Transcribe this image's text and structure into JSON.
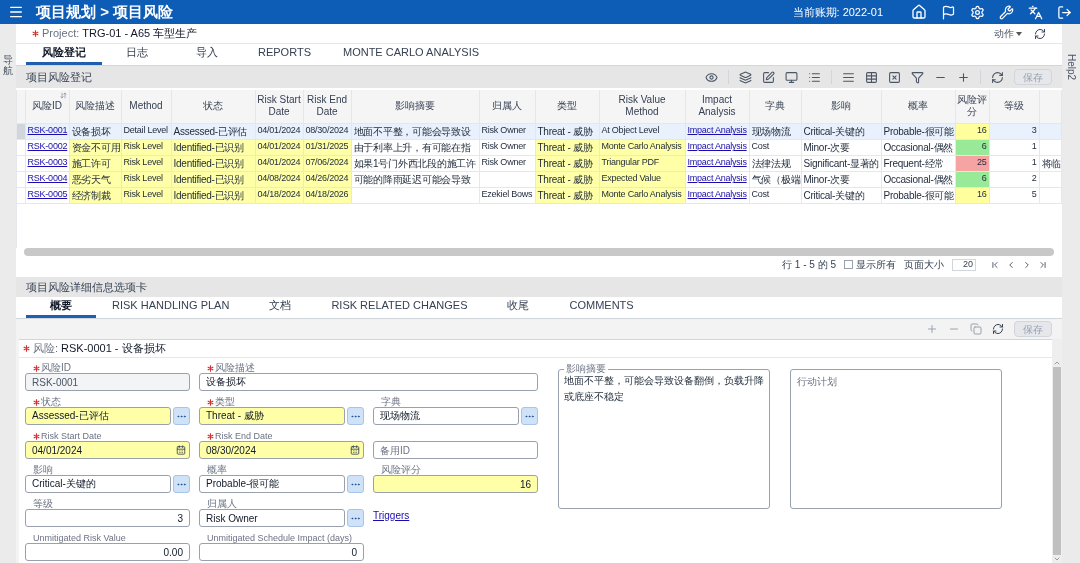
{
  "app_bar": {
    "title": "项目规划 > 项目风险",
    "period": "当前账期: 2022-01"
  },
  "side_panels": {
    "left": "导航",
    "right": "Help2"
  },
  "project": {
    "label": "Project:",
    "value": "TRG-01 - A65 车型生产",
    "required": true,
    "actions": "动作"
  },
  "tabs": [
    {
      "label": "风险登记",
      "selected": true
    },
    {
      "label": "日志",
      "selected": false
    },
    {
      "label": "导入",
      "selected": false
    },
    {
      "label": "REPORTS",
      "selected": false
    },
    {
      "label": "MONTE CARLO ANALYSIS",
      "selected": false
    }
  ],
  "register": {
    "title": "项目风险登记",
    "save": {
      "label": "保存",
      "disabled": true
    },
    "columns": [
      {
        "label": "风险ID",
        "kind": "link",
        "sorted": true
      },
      {
        "label": "风险描述",
        "kind": "required",
        "sorted": false
      },
      {
        "label": "Method",
        "kind": "required",
        "sorted": false
      },
      {
        "label": "状态",
        "kind": "required",
        "sorted": false
      },
      {
        "label": "Risk Start Date",
        "kind": "required",
        "sorted": false
      },
      {
        "label": "Risk End Date",
        "kind": "required",
        "sorted": false
      },
      {
        "label": "影响摘要",
        "kind": "text",
        "sorted": false
      },
      {
        "label": "归属人",
        "kind": "text",
        "sorted": false
      },
      {
        "label": "类型",
        "kind": "required",
        "sorted": false
      },
      {
        "label": "Risk Value Method",
        "kind": "required",
        "sorted": false
      },
      {
        "label": "Impact Analysis",
        "kind": "link",
        "sorted": false
      },
      {
        "label": "字典",
        "kind": "text",
        "sorted": false
      },
      {
        "label": "影响",
        "kind": "text",
        "sorted": false
      },
      {
        "label": "概率",
        "kind": "text",
        "sorted": false
      },
      {
        "label": "风险评分",
        "kind": "score",
        "sorted": false
      },
      {
        "label": "等级",
        "kind": "number",
        "sorted": false
      },
      {
        "kind": "text",
        "sorted": false
      }
    ],
    "rows": [
      {
        "selected": true,
        "color": "#ffff9e",
        "cells": [
          "RSK-0001",
          "设备损坏",
          "Detail Level",
          "Assessed-已评估",
          "04/01/2024",
          "08/30/2024",
          "地面不平整，可能会导致设",
          "Risk Owner",
          "Threat - 威胁",
          "At Object Level",
          "Impact Analysis",
          "现场物流",
          "Critical-关键的",
          "Probable-很可能",
          "16",
          "3",
          null
        ]
      },
      {
        "selected": false,
        "color": "#98e998",
        "cells": [
          "RSK-0002",
          "资金不可用",
          "Risk Level",
          "Identified-已识别",
          "04/01/2024",
          "01/31/2025",
          "由于利率上升，有可能在指",
          "Risk Owner",
          "Threat - 威胁",
          "Monte Carlo Analysis",
          "Impact Analysis",
          "Cost",
          "Minor-次要",
          "Occasional-偶然",
          "6",
          "1",
          null
        ]
      },
      {
        "selected": false,
        "color": "#f5a3a3",
        "cells": [
          "RSK-0003",
          "施工许可",
          "Risk Level",
          "Identified-已识别",
          "04/01/2024",
          "07/06/2024",
          "如果1号门外西北段的施工许",
          "Risk Owner",
          "Threat - 威胁",
          "Triangular PDF",
          "Impact Analysis",
          "法律法规",
          "Significant-显著的",
          "Frequent-经常",
          "25",
          "1",
          "将临"
        ]
      },
      {
        "selected": false,
        "color": "#98e998",
        "cells": [
          "RSK-0004",
          "恶劣天气",
          "Risk Level",
          "Identified-已识别",
          "04/08/2024",
          "04/26/2024",
          "可能的降雨延迟可能会导致",
          "",
          "Threat - 威胁",
          "Expected Value",
          "Impact Analysis",
          "气候（极端",
          "Minor-次要",
          "Occasional-偶然",
          "6",
          "2",
          null
        ]
      },
      {
        "selected": false,
        "color": "#ffff9e",
        "cells": [
          "RSK-0005",
          "经济制裁",
          "Risk Level",
          "Identified-已识别",
          "04/18/2024",
          "04/18/2026",
          null,
          "Ezekiel Bows",
          "Threat - 威胁",
          "Monte Carlo Analysis",
          "Impact Analysis",
          "Cost",
          "Critical-关键的",
          "Probable-很可能",
          "16",
          "5",
          null
        ]
      }
    ],
    "pagination": {
      "summary": "行 1 - 5 的 5",
      "show_all": {
        "label": "显示所有",
        "checked": false
      },
      "page_size_label": "页面大小",
      "page_size": "20"
    }
  },
  "detail": {
    "title": "项目风险详细信息选项卡",
    "tabs": [
      {
        "label": "概要",
        "selected": true
      },
      {
        "label": "RISK HANDLING PLAN",
        "selected": false
      },
      {
        "label": "文档",
        "selected": false
      },
      {
        "label": "RISK RELATED CHANGES",
        "selected": false
      },
      {
        "label": "收尾",
        "selected": false
      },
      {
        "label": "COMMENTS",
        "selected": false
      }
    ],
    "save": {
      "label": "保存",
      "disabled": true
    },
    "record": {
      "label": "风险:",
      "value": "RSK-0001 - 设备损坏",
      "required": true
    },
    "fields": [
      [
        {
          "kind": "text",
          "label": "风险ID",
          "value": "RSK-0001",
          "required": true,
          "highlighted": false,
          "disabled": true
        },
        {
          "kind": "wide",
          "label": "风险描述",
          "value": "设备损坏",
          "required": true,
          "highlighted": false,
          "disabled": false
        }
      ],
      [
        {
          "kind": "lookup",
          "label": "状态",
          "value": "Assessed-已评估",
          "required": true,
          "highlighted": true,
          "disabled": false
        },
        {
          "kind": "lookup",
          "label": "类型",
          "value": "Threat - 威胁",
          "required": true,
          "highlighted": true,
          "disabled": false
        },
        {
          "kind": "lookup",
          "label": "字典",
          "value": "现场物流",
          "required": false,
          "highlighted": false,
          "disabled": false
        }
      ],
      [
        {
          "kind": "date",
          "label": "Risk Start Date",
          "value": "04/01/2024",
          "required": true,
          "highlighted": true,
          "disabled": false
        },
        {
          "kind": "date",
          "label": "Risk End Date",
          "value": "08/30/2024",
          "required": true,
          "highlighted": true,
          "disabled": false
        },
        {
          "kind": "text",
          "placeholder": "备用ID",
          "required": false,
          "highlighted": false,
          "disabled": false
        }
      ],
      [
        {
          "kind": "lookup",
          "label": "影响",
          "value": "Critical-关键的",
          "required": false,
          "highlighted": false,
          "disabled": false
        },
        {
          "kind": "lookup",
          "label": "概率",
          "value": "Probable-很可能",
          "required": false,
          "highlighted": false,
          "disabled": false
        },
        {
          "kind": "number",
          "label": "风险评分",
          "value": "16",
          "required": false,
          "highlighted": true,
          "disabled": false
        }
      ],
      [
        {
          "kind": "number",
          "label": "等级",
          "value": "3",
          "required": false,
          "highlighted": false,
          "disabled": false
        },
        {
          "kind": "lookup",
          "label": "归属人",
          "value": "Risk Owner",
          "required": false,
          "highlighted": false,
          "disabled": false
        },
        {
          "kind": "link",
          "label": "Triggers",
          "required": false,
          "highlighted": false,
          "disabled": false
        }
      ],
      [
        {
          "kind": "number",
          "label": "Unmitigated Risk Value",
          "value": "0.00",
          "required": false,
          "highlighted": false,
          "disabled": false
        },
        {
          "kind": "number",
          "label": "Unmitigated Schedule Impact (days)",
          "value": "0",
          "required": false,
          "highlighted": false,
          "disabled": false
        }
      ]
    ],
    "impact_summary": {
      "label": "影响摘要",
      "value": "地面不平整，可能会导致设备翻倒，负载升降或底座不稳定"
    },
    "action_plan": {
      "placeholder": "行动计划"
    }
  }
}
